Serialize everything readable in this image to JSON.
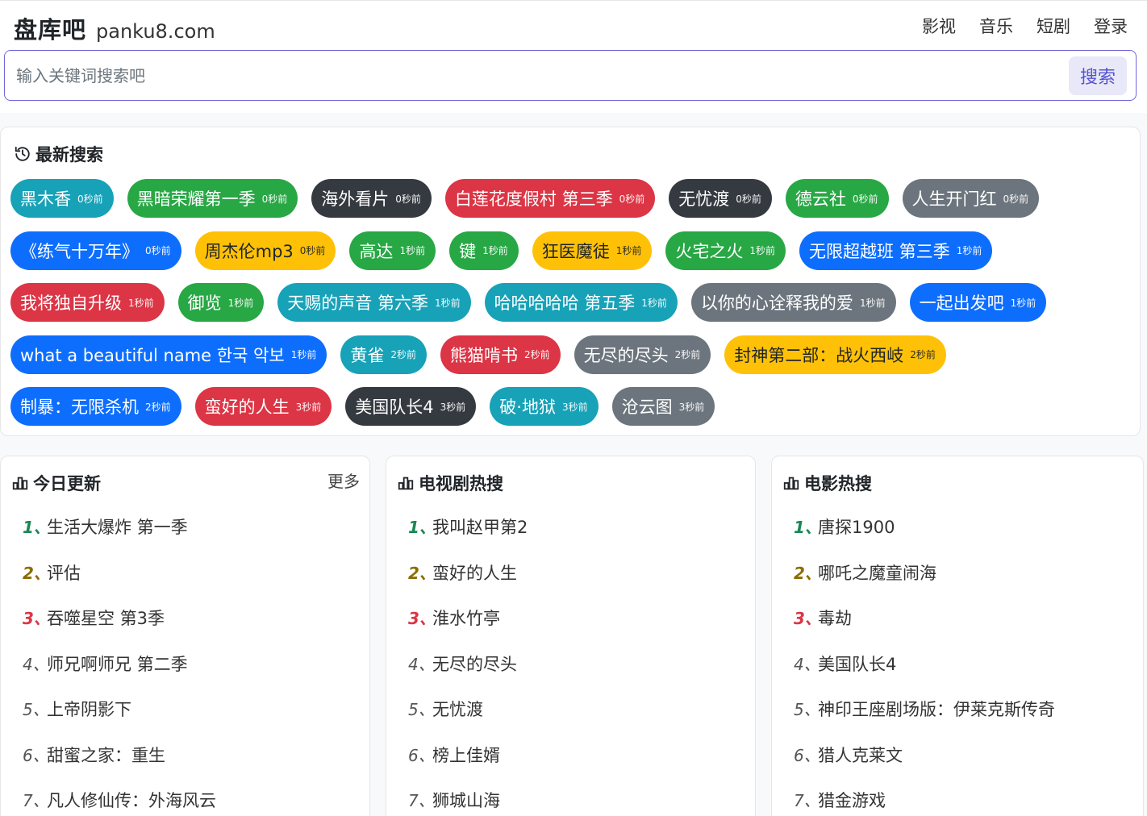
{
  "header": {
    "brand_name": "盘库吧",
    "brand_domain": "panku8.com",
    "nav": [
      "影视",
      "音乐",
      "短剧",
      "登录"
    ]
  },
  "search": {
    "placeholder": "输入关键词搜索吧",
    "button": "搜索"
  },
  "recent": {
    "title": "最新搜索",
    "rows": [
      [
        {
          "text": "黑木香",
          "time": "0秒前",
          "color": "#17a2b8"
        },
        {
          "text": "黑暗荣耀第一季",
          "time": "0秒前",
          "color": "#28a745"
        },
        {
          "text": "海外看片",
          "time": "0秒前",
          "color": "#343a40"
        },
        {
          "text": "白莲花度假村 第三季",
          "time": "0秒前",
          "color": "#dc3545"
        },
        {
          "text": "无忧渡",
          "time": "0秒前",
          "color": "#343a40"
        },
        {
          "text": "德云社",
          "time": "0秒前",
          "color": "#28a745"
        },
        {
          "text": "人生开门红",
          "time": "0秒前",
          "color": "#6c757d"
        }
      ],
      [
        {
          "text": "《练气十万年》",
          "time": "0秒前",
          "color": "#0d6efd"
        },
        {
          "text": "周杰伦mp3",
          "time": "0秒前",
          "color": "#ffc107"
        },
        {
          "text": "高达",
          "time": "1秒前",
          "color": "#28a745"
        },
        {
          "text": "键",
          "time": "1秒前",
          "color": "#28a745"
        },
        {
          "text": "狂医魔徒",
          "time": "1秒前",
          "color": "#ffc107"
        },
        {
          "text": "火宅之火",
          "time": "1秒前",
          "color": "#28a745"
        },
        {
          "text": "无限超越班 第三季",
          "time": "1秒前",
          "color": "#0d6efd"
        }
      ],
      [
        {
          "text": "我将独自升级",
          "time": "1秒前",
          "color": "#dc3545"
        },
        {
          "text": "御览",
          "time": "1秒前",
          "color": "#28a745"
        },
        {
          "text": "天赐的声音 第六季",
          "time": "1秒前",
          "color": "#17a2b8"
        },
        {
          "text": "哈哈哈哈哈 第五季",
          "time": "1秒前",
          "color": "#17a2b8"
        },
        {
          "text": "以你的心诠释我的爱",
          "time": "1秒前",
          "color": "#6c757d"
        },
        {
          "text": "一起出发吧",
          "time": "1秒前",
          "color": "#0d6efd"
        }
      ],
      [
        {
          "text": "what a beautiful name 한국 악보",
          "time": "1秒前",
          "color": "#0d6efd"
        },
        {
          "text": "黄雀",
          "time": "2秒前",
          "color": "#17a2b8"
        },
        {
          "text": "熊猫啃书",
          "time": "2秒前",
          "color": "#dc3545"
        },
        {
          "text": "无尽的尽头",
          "time": "2秒前",
          "color": "#6c757d"
        },
        {
          "text": "封神第二部：战火西岐",
          "time": "2秒前",
          "color": "#ffc107"
        }
      ],
      [
        {
          "text": "制暴：无限杀机",
          "time": "2秒前",
          "color": "#0d6efd"
        },
        {
          "text": "蛮好的人生",
          "time": "3秒前",
          "color": "#dc3545"
        },
        {
          "text": "美国队长4",
          "time": "3秒前",
          "color": "#343a40"
        },
        {
          "text": "破·地狱",
          "time": "3秒前",
          "color": "#17a2b8"
        },
        {
          "text": "沧云图",
          "time": "3秒前",
          "color": "#6c757d"
        }
      ]
    ]
  },
  "lists": [
    {
      "title": "今日更新",
      "more": "更多",
      "items": [
        "生活大爆炸 第一季",
        "评估",
        "吞噬星空 第3季",
        "师兄啊师兄 第二季",
        "上帝阴影下",
        "甜蜜之家：重生",
        "凡人修仙传：外海风云"
      ]
    },
    {
      "title": "电视剧热搜",
      "more": "",
      "items": [
        "我叫赵甲第2",
        "蛮好的人生",
        "淮水竹亭",
        "无尽的尽头",
        "无忧渡",
        "榜上佳婿",
        "狮城山海"
      ]
    },
    {
      "title": "电影热搜",
      "more": "",
      "items": [
        "唐探1900",
        "哪吒之魔童闹海",
        "毒劫",
        "美国队长4",
        "神印王座剧场版：伊莱克斯传奇",
        "猎人克莱文",
        "猎金游戏"
      ]
    }
  ]
}
